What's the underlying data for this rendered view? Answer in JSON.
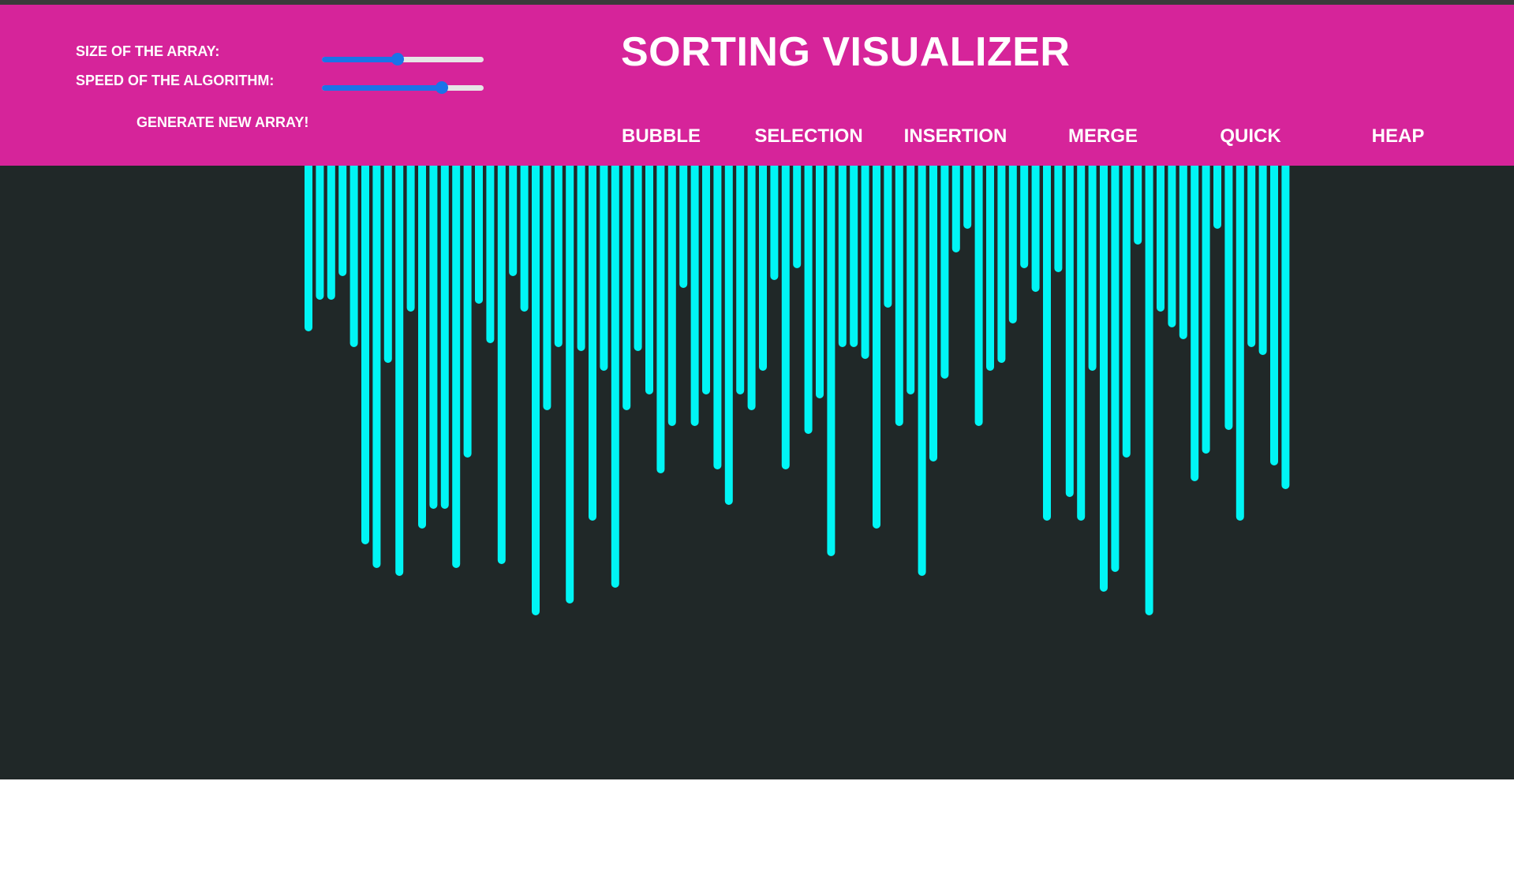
{
  "header": {
    "title": "SORTING VISUALIZER",
    "size_label": "SIZE OF THE ARRAY:",
    "speed_label": "SPEED OF THE ALGORITHM:",
    "size_value": 0.47,
    "speed_value": 0.74,
    "generate_label": "GENERATE NEW ARRAY!",
    "algorithms": [
      "BUBBLE",
      "SELECTION",
      "INSERTION",
      "MERGE",
      "QUICK",
      "HEAP"
    ]
  },
  "colors": {
    "header_bg": "#d6249a",
    "stage_bg": "#202828",
    "bar": "#00f5f5",
    "slider_accent": "#1a73e8"
  },
  "array": {
    "values": [
      210,
      170,
      170,
      140,
      230,
      480,
      510,
      250,
      520,
      185,
      460,
      435,
      435,
      510,
      370,
      175,
      225,
      505,
      140,
      185,
      570,
      310,
      230,
      555,
      235,
      450,
      260,
      535,
      310,
      235,
      290,
      390,
      330,
      155,
      330,
      290,
      385,
      430,
      290,
      310,
      260,
      145,
      385,
      130,
      340,
      295,
      495,
      230,
      230,
      245,
      460,
      180,
      330,
      290,
      520,
      375,
      270,
      110,
      80,
      330,
      260,
      250,
      200,
      130,
      160,
      450,
      135,
      420,
      450,
      260,
      540,
      515,
      370,
      100,
      570,
      185,
      205,
      220,
      400,
      365,
      80,
      335,
      450,
      230,
      240,
      380,
      410
    ]
  }
}
